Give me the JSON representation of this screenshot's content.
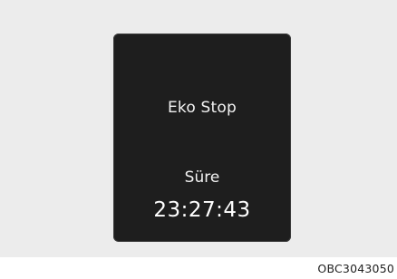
{
  "display": {
    "title": "Eko Stop",
    "duration_label": "Süre",
    "duration_value": "23:27:43"
  },
  "figure_code": "OBC3043050",
  "colors": {
    "screen_background": "#1e1e1e",
    "screen_text": "#f2f2f2",
    "surround_background": "#ececec"
  }
}
